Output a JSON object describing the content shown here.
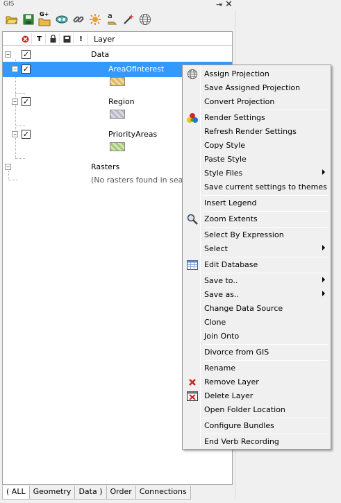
{
  "panel": {
    "title": "GIS"
  },
  "toolbar": {
    "buttons": [
      "open-icon",
      "save-icon",
      "add-layer-icon",
      "view-icon",
      "link-icon",
      "render-icon",
      "label-icon",
      "magic-wand-icon",
      "globe-icon"
    ],
    "add_layer_badge": "G+",
    "label_badge": "a"
  },
  "tree": {
    "header": {
      "col_t": "T",
      "col_excl": "!",
      "layer_label": "Layer"
    },
    "nodes": {
      "data": "Data",
      "area": "AreaOfInterest",
      "region": "Region",
      "priority": "PriorityAreas",
      "rasters": "Rasters",
      "no_rasters": "(No rasters found in search"
    },
    "swatch_colors": {
      "area": "#e0b860",
      "region": "#b8b8c8",
      "priority": "#a8c878"
    }
  },
  "tabs": [
    "( ALL",
    "Geometry",
    "Data )",
    "Order",
    "Connections"
  ],
  "menu": {
    "items": {
      "assign_projection": "Assign Projection",
      "save_assigned_projection": "Save Assigned Projection",
      "convert_projection": "Convert Projection",
      "render_settings": "Render Settings",
      "refresh_render_settings": "Refresh Render Settings",
      "copy_style": "Copy Style",
      "paste_style": "Paste Style",
      "style_files": "Style Files",
      "save_settings_themes": "Save current settings to themes",
      "insert_legend": "Insert Legend",
      "zoom_extents": "Zoom Extents",
      "select_by_expression": "Select By Expression",
      "select": "Select",
      "edit_database": "Edit Database",
      "save_to": "Save to..",
      "save_as": "Save as..",
      "change_data_source": "Change Data Source",
      "clone": "Clone",
      "join_onto": "Join Onto",
      "divorce_from_gis": "Divorce from GIS",
      "rename": "Rename",
      "remove_layer": "Remove Layer",
      "delete_layer": "Delete Layer",
      "open_folder_location": "Open Folder Location",
      "configure_bundles": "Configure Bundles",
      "end_verb_recording": "End Verb Recording"
    }
  },
  "colors": {
    "selection": "#3399ff",
    "accent_red": "#cc2222"
  }
}
